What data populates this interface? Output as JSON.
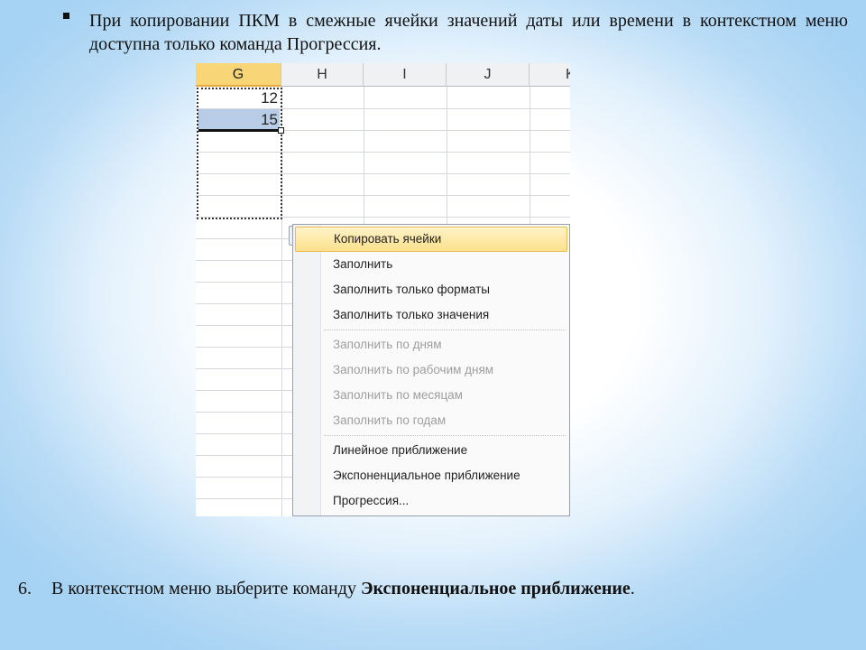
{
  "bullet": {
    "text": "При копировании ПКМ в смежные ячейки значений даты или времени в контекстном меню доступна только команда Прогрессия."
  },
  "spreadsheet": {
    "columns": [
      "G",
      "H",
      "I",
      "J",
      "K"
    ],
    "selected_column": "G",
    "cells": {
      "G1": "12",
      "G2": "15"
    }
  },
  "context_menu": {
    "items": [
      {
        "label": "Копировать ячейки",
        "state": "hover"
      },
      {
        "label": "Заполнить",
        "state": "enabled"
      },
      {
        "label": "Заполнить только форматы",
        "state": "enabled"
      },
      {
        "label": "Заполнить только значения",
        "state": "enabled"
      },
      {
        "label": "Заполнить по дням",
        "state": "disabled"
      },
      {
        "label": "Заполнить по рабочим дням",
        "state": "disabled"
      },
      {
        "label": "Заполнить по месяцам",
        "state": "disabled"
      },
      {
        "label": "Заполнить по годам",
        "state": "disabled"
      },
      {
        "label": "Линейное приближение",
        "state": "enabled"
      },
      {
        "label": "Экспоненциальное приближение",
        "state": "enabled"
      },
      {
        "label": "Прогрессия...",
        "state": "enabled"
      }
    ]
  },
  "step": {
    "number": "6.",
    "text_before": "В контекстном меню выберите команду ",
    "command": "Экспоненциальное приближение",
    "text_after": "."
  },
  "colors": {
    "selected_header": "#f8d577",
    "highlight_cell": "#b8cce8",
    "menu_hover": "#fde08c",
    "background_edge": "#a6d2f3"
  }
}
